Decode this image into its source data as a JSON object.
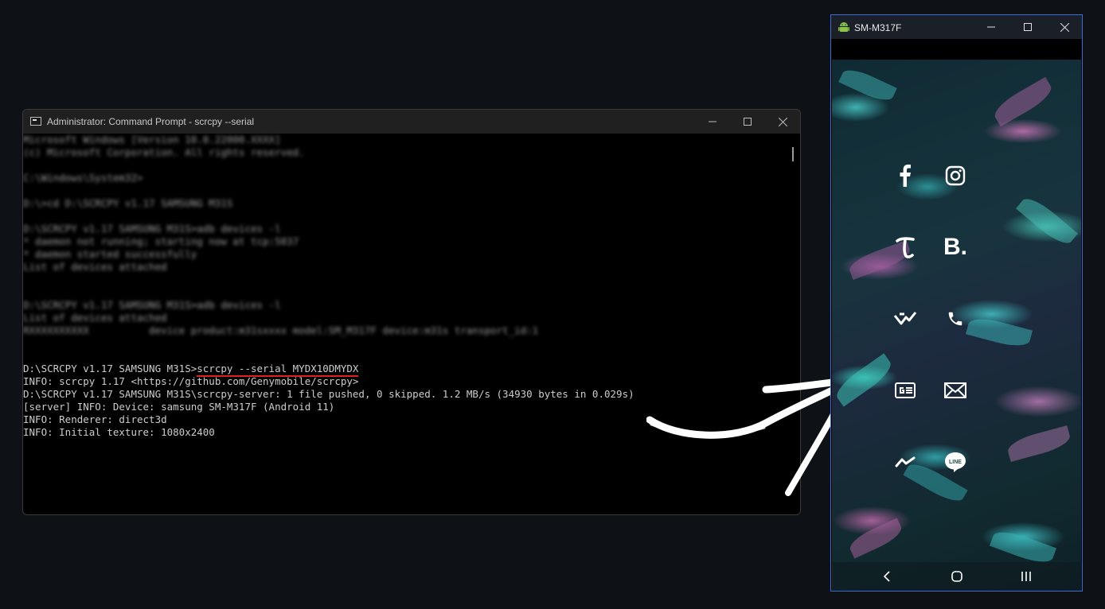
{
  "cmd_window": {
    "title": "Administrator: Command Prompt - scrcpy  --serial",
    "blurred_lines": [
      "Microsoft Windows [Version 10.0.22000.XXXX]",
      "(c) Microsoft Corporation. All rights reserved.",
      "",
      "C:\\Windows\\System32>",
      "",
      "D:\\>cd D:\\SCRCPY v1.17 SAMSUNG M31S",
      "",
      "D:\\SCRCPY v1.17 SAMSUNG M31S>adb devices -l",
      "* daemon not running; starting now at tcp:5037",
      "* daemon started successfully",
      "List of devices attached",
      "",
      "",
      "D:\\SCRCPY v1.17 SAMSUNG M31S>adb devices -l",
      "List of devices attached",
      "RXXXXXXXXXX          device product:m31sxxxx model:SM_M317F device:m31s transport_id:1"
    ],
    "prompt": "D:\\SCRCPY v1.17 SAMSUNG M31S>",
    "command": "scrcpy --serial MYDX10DMYDX",
    "output_lines": [
      "INFO: scrcpy 1.17 <https://github.com/Genymobile/scrcpy>",
      "D:\\SCRCPY v1.17 SAMSUNG M31S\\scrcpy-server: 1 file pushed, 0 skipped. 1.2 MB/s (34930 bytes in 0.029s)",
      "[server] INFO: Device: samsung SM-M317F (Android 11)",
      "INFO: Renderer: direct3d",
      "INFO: Initial texture: 1080x2400"
    ],
    "underline_color": "#e0201f"
  },
  "phone_window": {
    "title": "SM-M317F",
    "border_color": "#3b6bd4",
    "apps": [
      {
        "name": "facebook-icon"
      },
      {
        "name": "instagram-icon"
      },
      {
        "name": "tumblr-icon"
      },
      {
        "name": "behance-icon",
        "glyph": "B."
      },
      {
        "name": "vk-icon"
      },
      {
        "name": "phone-icon"
      },
      {
        "name": "google-news-icon"
      },
      {
        "name": "mail-icon"
      },
      {
        "name": "messenger-icon"
      },
      {
        "name": "line-icon",
        "glyph": "LINE"
      }
    ],
    "nav": [
      "back-icon",
      "home-icon",
      "recents-icon"
    ]
  }
}
